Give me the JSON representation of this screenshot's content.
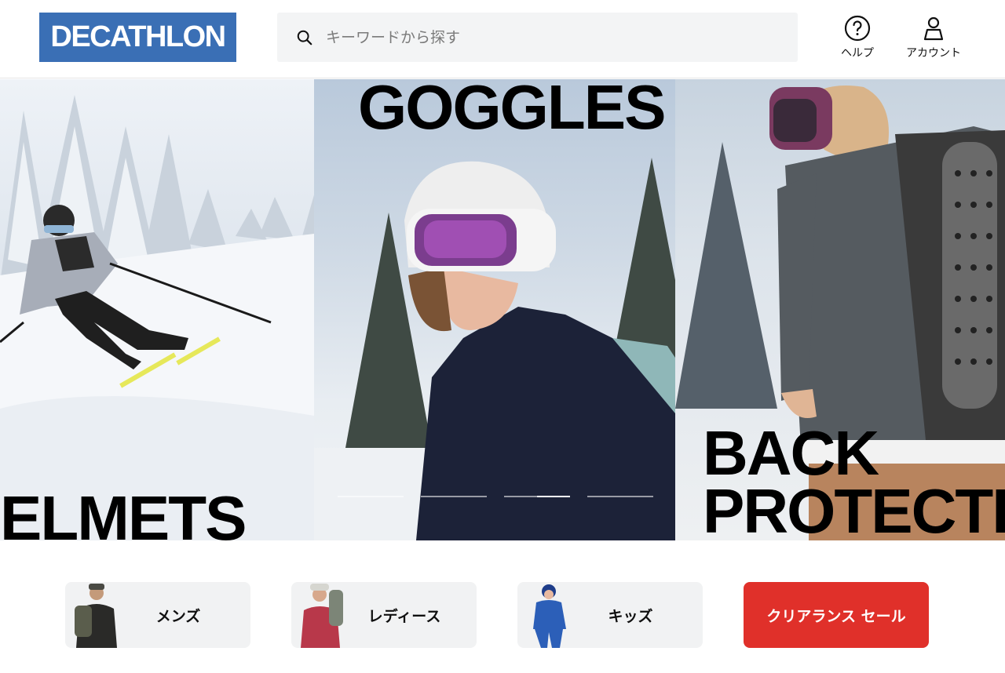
{
  "header": {
    "logo_text": "DECATHLON",
    "search_placeholder": "キーワードから探す",
    "help_label": "ヘルプ",
    "account_label": "アカウント"
  },
  "hero": {
    "text_goggles": "GOGGLES",
    "text_helmets": "ELMETS",
    "text_back_line1": "BACK",
    "text_back_line2": "PROTECTIC",
    "slides_count": 4,
    "active_slide": 4
  },
  "categories": {
    "mens": "メンズ",
    "ladies": "レディース",
    "kids": "キッズ",
    "sale": "クリアランス セール"
  },
  "colors": {
    "brand_blue": "#3a6fb5",
    "sale_red": "#e0302a",
    "button_bg": "#f1f2f3"
  }
}
